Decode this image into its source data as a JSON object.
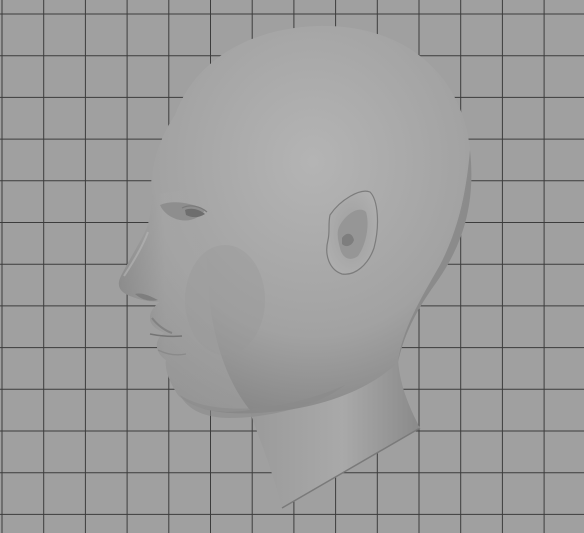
{
  "viewport": {
    "view": "side",
    "background_color": "#a0a0a0",
    "grid_line_color": "#3c3c3c",
    "grid_visible": true
  },
  "scene": {
    "object": "head-model",
    "surface_color": "#a8a8a8",
    "shading": "smooth"
  }
}
